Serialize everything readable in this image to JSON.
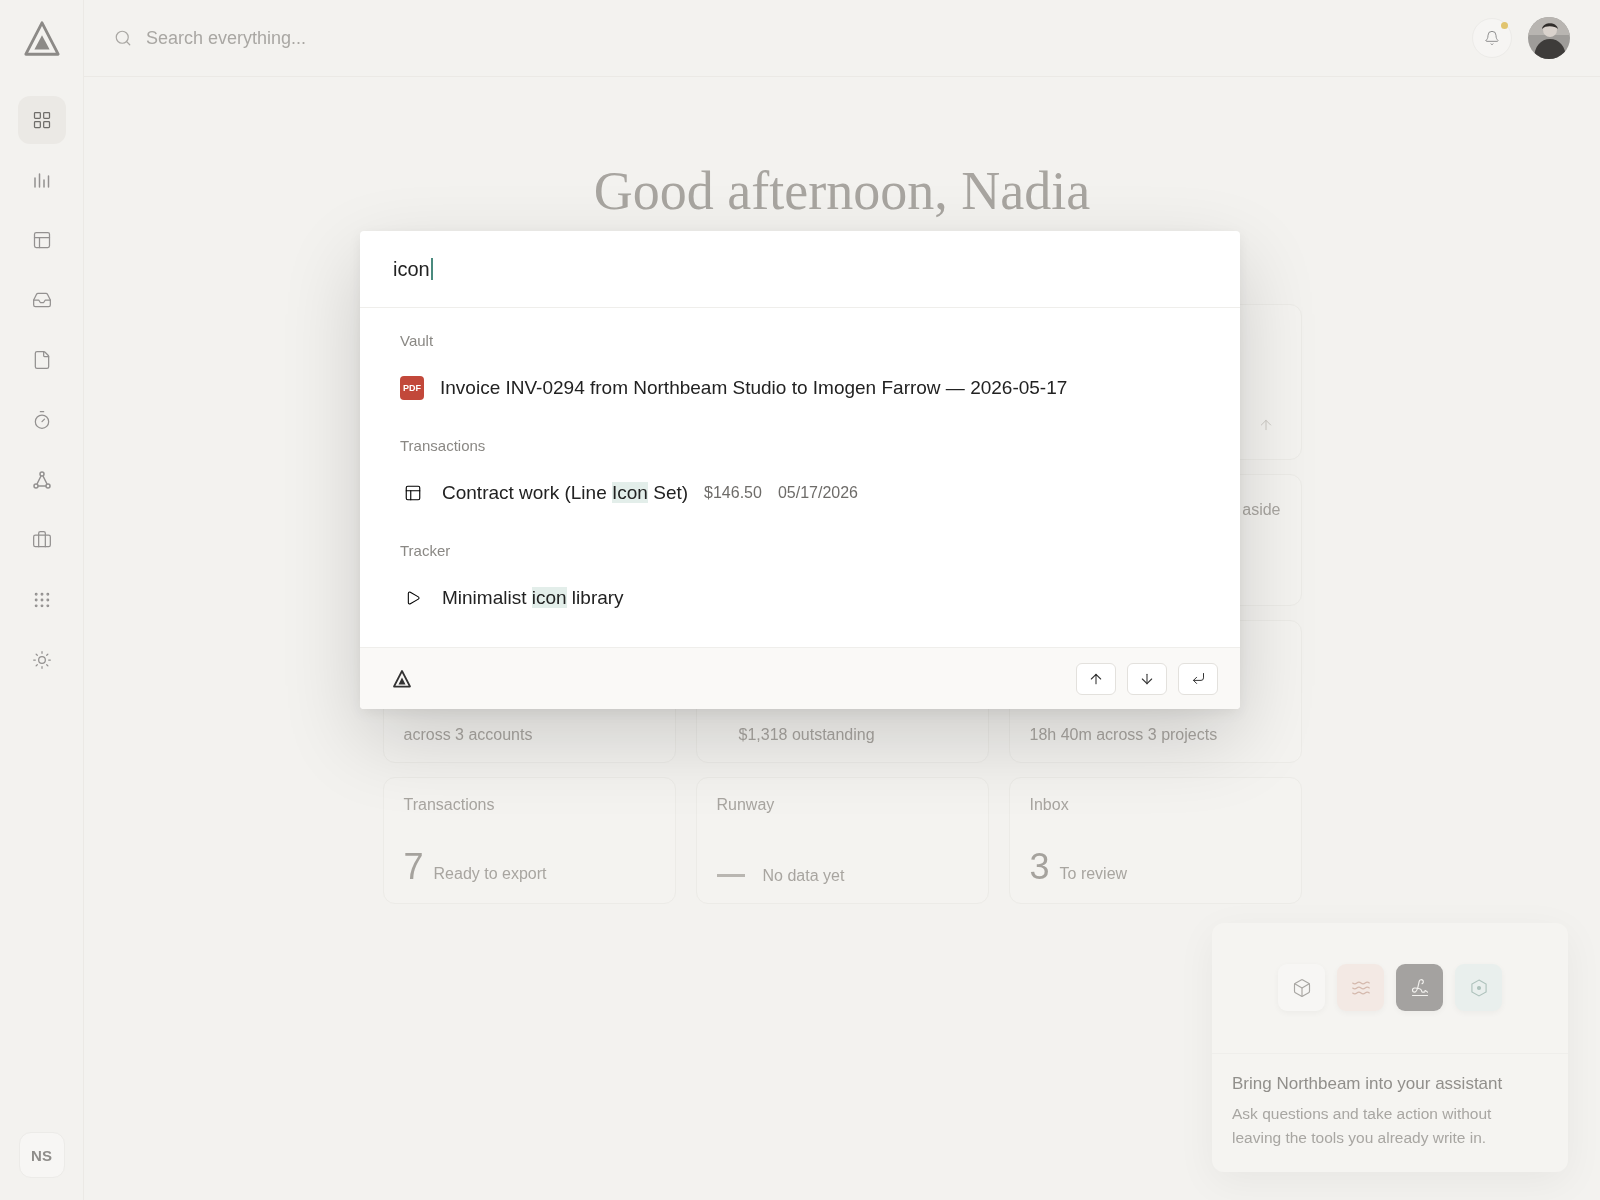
{
  "sidebar": {
    "items": [
      {
        "kind": "dashboard",
        "selected": true
      },
      {
        "kind": "reports",
        "selected": false
      },
      {
        "kind": "table",
        "selected": false
      },
      {
        "kind": "inbox",
        "selected": false
      },
      {
        "kind": "document",
        "selected": false
      },
      {
        "kind": "timer",
        "selected": false
      },
      {
        "kind": "graph",
        "selected": false
      },
      {
        "kind": "work",
        "selected": false
      },
      {
        "kind": "apps",
        "selected": false
      },
      {
        "kind": "theme",
        "selected": false
      }
    ],
    "user_initials": "NS"
  },
  "header": {
    "search_placeholder": "Search everything...",
    "notifications_unread": true
  },
  "greeting": "Good afternoon, Nadia",
  "cards": [
    {
      "kind": "note",
      "text": "aside"
    },
    {
      "kind": "note",
      "text": "across 3 accounts"
    },
    {
      "kind": "note",
      "text": "$1,318 outstanding"
    },
    {
      "kind": "note",
      "text": "18h 40m across 3 projects"
    },
    {
      "kind": "titled",
      "title": "Transactions",
      "value": "7",
      "text": "Ready to export"
    },
    {
      "kind": "empty",
      "title": "Runway",
      "text": "No data yet"
    },
    {
      "kind": "titled",
      "title": "Inbox",
      "value": "3",
      "text": "To review"
    }
  ],
  "palette": {
    "query": "icon",
    "groups": [
      {
        "title": "Vault",
        "results": [
          {
            "kind": "pdf",
            "badge": "PDF",
            "parts": [
              {
                "text": "Invoice INV-0294 from Northbeam Studio to Imogen Farrow — 2026-05-17",
                "match": false
              }
            ]
          }
        ]
      },
      {
        "title": "Transactions",
        "results": [
          {
            "kind": "transaction",
            "parts": [
              {
                "text": "Contract work (Line ",
                "match": false
              },
              {
                "text": "Icon",
                "match": true
              },
              {
                "text": " Set)",
                "match": false
              }
            ],
            "meta": [
              "$146.50",
              "05/17/2026"
            ]
          }
        ]
      },
      {
        "title": "Tracker",
        "results": [
          {
            "kind": "task",
            "parts": [
              {
                "text": "Minimalist ",
                "match": false
              },
              {
                "text": "icon",
                "match": true
              },
              {
                "text": " library",
                "match": false
              }
            ]
          }
        ]
      }
    ],
    "keys": [
      {
        "kind": "up"
      },
      {
        "kind": "down"
      },
      {
        "kind": "enter"
      }
    ]
  },
  "assistant": {
    "tiles": [
      {
        "kind": "cube",
        "active": false
      },
      {
        "kind": "waves",
        "active": false
      },
      {
        "kind": "signature",
        "active": true
      },
      {
        "kind": "hexagon",
        "active": false
      }
    ],
    "title": "Bring Northbeam into your assistant",
    "description": "Ask questions and take action without leaving the tools you already write in."
  }
}
